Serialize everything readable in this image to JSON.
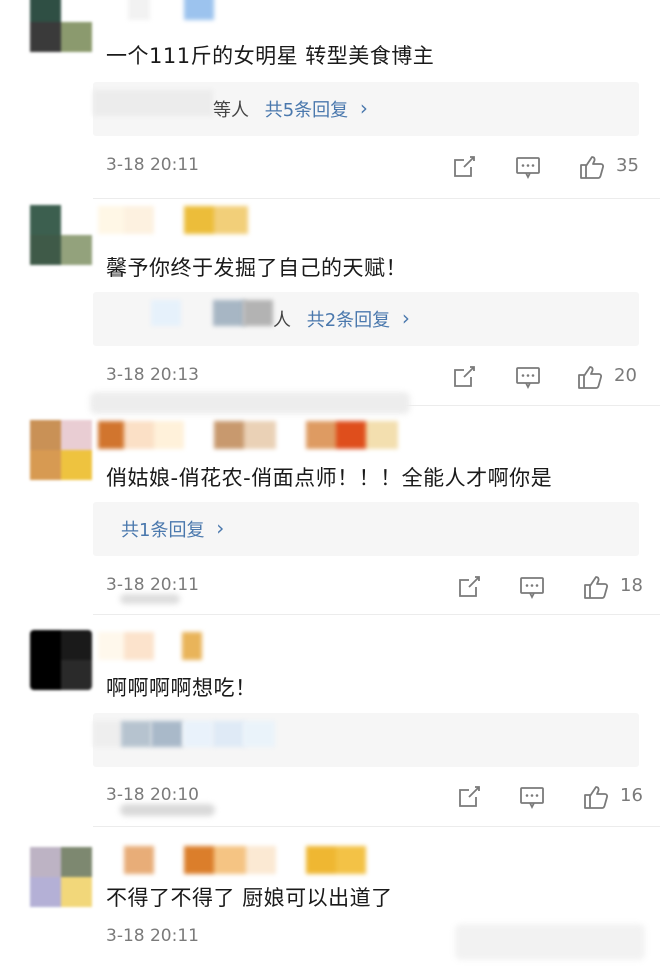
{
  "comments": [
    {
      "text": "一个111斤的女明星 转型美食博主",
      "reply_prefix": "等人",
      "reply_label": "共5条回复",
      "time": "3-18 20:11",
      "likes": "35",
      "avatar_colors": [
        "#2f4f44",
        "#ffffff",
        "#3a3a3a",
        "#8b9a6e"
      ]
    },
    {
      "text": "馨予你终于发掘了自己的天赋！",
      "reply_prefix": "人",
      "reply_label": "共2条回复",
      "time": "3-18 20:13",
      "likes": "20",
      "avatar_colors": [
        "#3c5f4f",
        "#ffffff",
        "#3f5a48",
        "#93a27c"
      ]
    },
    {
      "text": "俏姑娘-俏花农-俏面点师！！！全能人才啊你是",
      "reply_prefix": "",
      "reply_label": "共1条回复",
      "time": "3-18 20:11",
      "likes": "18",
      "avatar_colors": [
        "#c99156",
        "#e9cdd3",
        "#d79a52",
        "#eec33f"
      ]
    },
    {
      "text": "啊啊啊啊想吃！",
      "reply_prefix": "",
      "reply_label": "",
      "time": "3-18 20:10",
      "likes": "16",
      "avatar_colors": [
        "#000000",
        "#1a1a1a",
        "#000000",
        "#2a2a2a"
      ]
    },
    {
      "text": "不得了不得了 厨娘可以出道了",
      "reply_prefix": "",
      "reply_label": "",
      "time": "3-18 20:11",
      "likes": "",
      "avatar_colors": [
        "#bdb3c4",
        "#7d8870",
        "#b4b0d6",
        "#f2d77a"
      ]
    }
  ],
  "icons": {
    "share": "share-icon",
    "comment": "comment-icon",
    "like": "like-icon"
  },
  "colors": {
    "link": "#4a78ad",
    "meta": "#7a7a7a",
    "reply_bg": "#f6f6f6"
  }
}
